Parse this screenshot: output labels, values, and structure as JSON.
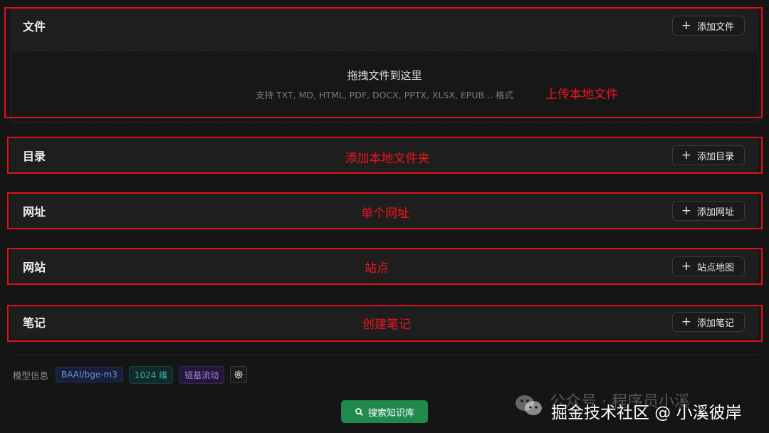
{
  "sections": {
    "files": {
      "title": "文件",
      "button": "添加文件",
      "drop_title": "拖拽文件到这里",
      "drop_hint": "支持 TXT, MD, HTML, PDF, DOCX, PPTX, XLSX, EPUB... 格式",
      "annotation": "上传本地文件"
    },
    "directory": {
      "title": "目录",
      "button": "添加目录",
      "annotation": "添加本地文件夹"
    },
    "url": {
      "title": "网址",
      "button": "添加网址",
      "annotation": "单个网址"
    },
    "website": {
      "title": "网站",
      "button": "站点地图",
      "annotation": "站点"
    },
    "notes": {
      "title": "笔记",
      "button": "添加笔记",
      "annotation": "创建笔记"
    }
  },
  "model": {
    "label": "模型信息",
    "tags": [
      "BAAI/bge-m3",
      "1024 维",
      "链基流动"
    ],
    "settings_icon": "gear-icon"
  },
  "search_button": "搜索知识库",
  "watermark": {
    "line1": "公众号 · 程序员小溪",
    "line2": "掘金技术社区 @ 小溪彼岸",
    "icon": "wechat-icon"
  },
  "colors": {
    "annotation": "#f0141e",
    "search_button": "#1f8a4c",
    "background": "#151515",
    "section": "#1e1e1f"
  }
}
